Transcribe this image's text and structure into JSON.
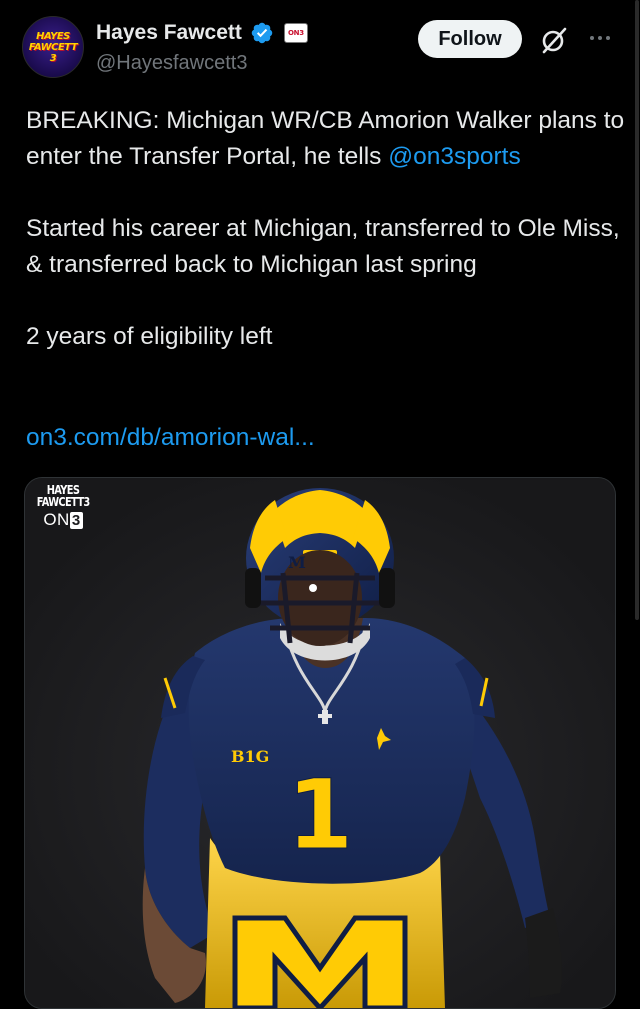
{
  "author": {
    "name": "Hayes Fawcett",
    "handle": "@Hayesfawcett3",
    "avatar_text": [
      "HAYES",
      "FAWCETT",
      "3"
    ],
    "org_badge": "ON3"
  },
  "actions": {
    "follow_label": "Follow",
    "grok_icon": "grok-icon",
    "more_icon": "more-icon"
  },
  "tweet": {
    "line1": "BREAKING: Michigan WR/CB Amorion Walker plans to enter the Transfer Portal, he tells",
    "mention": "@on3sports",
    "line2": "Started his career at Michigan, transferred to Ole Miss, & transferred back to Michigan last spring",
    "line3": "2 years of eligibility left",
    "link": "on3.com/db/amorion-wal..."
  },
  "media": {
    "watermark_lines": [
      "HAYES",
      "FAWCETT3"
    ],
    "watermark_on": "ON",
    "watermark_3": "3",
    "helmet_letter": "M",
    "conference_patch": "B1G",
    "jersey_number": "1"
  },
  "colors": {
    "background": "#000000",
    "text": "#e7e9ea",
    "secondary": "#71767b",
    "link": "#1d9bf0",
    "verified": "#1d9bf0",
    "maize": "#ffcb05",
    "navy": "#1f3366"
  }
}
